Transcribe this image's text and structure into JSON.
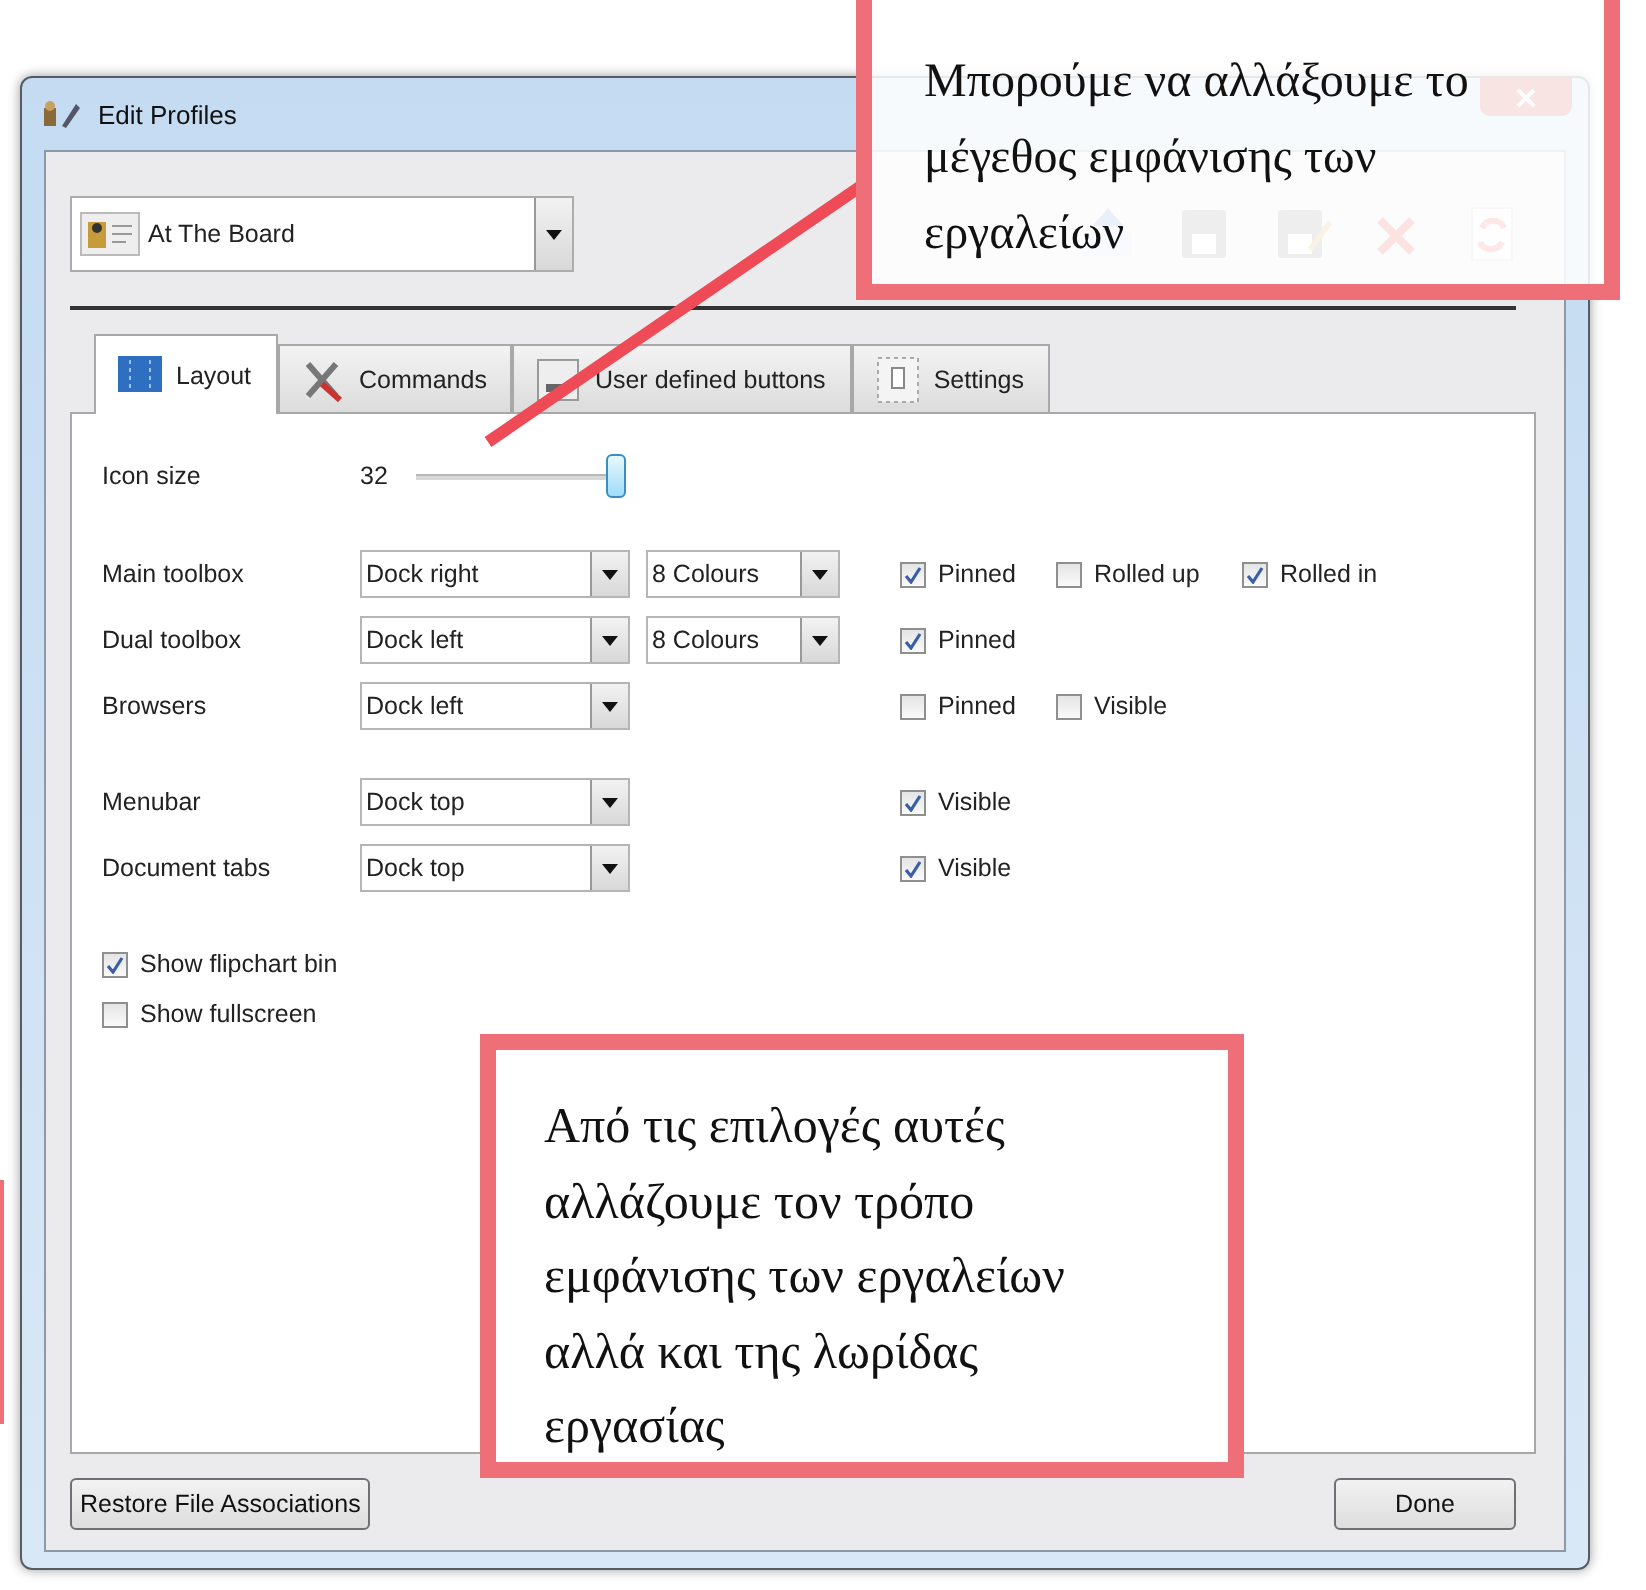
{
  "window": {
    "title": "Edit Profiles"
  },
  "profile_select": {
    "value": "At The Board"
  },
  "tabs": [
    {
      "label": "Layout",
      "selected": true,
      "kind": "layout"
    },
    {
      "label": "Commands",
      "selected": false,
      "kind": "commands"
    },
    {
      "label": "User defined buttons",
      "selected": false,
      "kind": "user"
    },
    {
      "label": "Settings",
      "selected": false,
      "kind": "settings"
    }
  ],
  "icon_size": {
    "label": "Icon size",
    "value": "32",
    "level": 1
  },
  "dock_groups": [
    {
      "rows": [
        {
          "label": "Main toolbox",
          "position": "Dock right",
          "colours": "8 Colours",
          "checks": [
            {
              "label": "Pinned",
              "checked": true
            },
            {
              "label": "Rolled up",
              "checked": false
            },
            {
              "label": "Rolled in",
              "checked": true
            }
          ]
        },
        {
          "label": "Dual toolbox",
          "position": "Dock left",
          "colours": "8 Colours",
          "checks": [
            {
              "label": "Pinned",
              "checked": true
            }
          ]
        },
        {
          "label": "Browsers",
          "position": "Dock left",
          "checks": [
            {
              "label": "Pinned",
              "checked": false
            },
            {
              "label": "Visible",
              "checked": false
            }
          ]
        }
      ]
    },
    {
      "rows": [
        {
          "label": "Menubar",
          "position": "Dock top",
          "checks": [
            {
              "label": "Visible",
              "checked": true
            }
          ]
        },
        {
          "label": "Document tabs",
          "position": "Dock top",
          "checks": [
            {
              "label": "Visible",
              "checked": true
            }
          ]
        }
      ]
    }
  ],
  "options": [
    {
      "label": "Show flipchart bin",
      "checked": true
    },
    {
      "label": "Show fullscreen",
      "checked": false
    }
  ],
  "buttons": [
    {
      "label": "Restore File Associations",
      "kind": "left"
    },
    {
      "label": "Done",
      "kind": "right"
    }
  ],
  "annotations": [
    {
      "text": "Μπορούμε να αλλάξουμε το μέγεθος εμφάνισης των εργαλείων",
      "kind": "top"
    },
    {
      "text": "Από τις επιλογές αυτές αλλάζουμε τον τρόπο εμφάνισης των εργαλείων αλλά και της λωρίδας εργασίας",
      "kind": "bottom"
    }
  ]
}
